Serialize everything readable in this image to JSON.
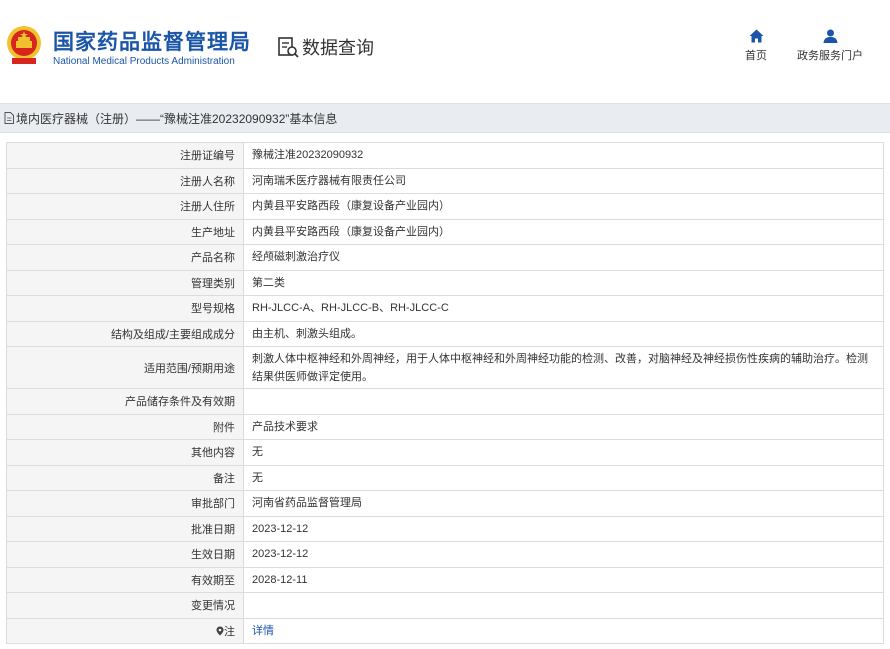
{
  "header": {
    "title_cn": "国家药品监督管理局",
    "title_en": "National Medical Products Administration",
    "query_label": "数据查询",
    "nav": {
      "home": "首页",
      "portal": "政务服务门户"
    }
  },
  "breadcrumb": {
    "text": "境内医疗器械（注册）——“豫械注准20232090932”基本信息"
  },
  "rows": [
    {
      "label": "注册证编号",
      "value": "豫械注准20232090932"
    },
    {
      "label": "注册人名称",
      "value": "河南瑞禾医疗器械有限责任公司"
    },
    {
      "label": "注册人住所",
      "value": "内黄县平安路西段（康复设备产业园内）"
    },
    {
      "label": "生产地址",
      "value": "内黄县平安路西段（康复设备产业园内）"
    },
    {
      "label": "产品名称",
      "value": "经颅磁刺激治疗仪"
    },
    {
      "label": "管理类别",
      "value": "第二类"
    },
    {
      "label": "型号规格",
      "value": "RH-JLCC-A、RH-JLCC-B、RH-JLCC-C"
    },
    {
      "label": "结构及组成/主要组成成分",
      "value": "由主机、刺激头组成。"
    },
    {
      "label": "适用范围/预期用途",
      "value": "刺激人体中枢神经和外周神经，用于人体中枢神经和外周神经功能的检测、改善，对脑神经及神经损伤性疾病的辅助治疗。检测结果供医师做评定使用。"
    },
    {
      "label": "产品储存条件及有效期",
      "value": ""
    },
    {
      "label": "附件",
      "value": "产品技术要求"
    },
    {
      "label": "其他内容",
      "value": "无"
    },
    {
      "label": "备注",
      "value": "无"
    },
    {
      "label": "审批部门",
      "value": "河南省药品监督管理局"
    },
    {
      "label": "批准日期",
      "value": "2023-12-12"
    },
    {
      "label": "生效日期",
      "value": "2023-12-12"
    },
    {
      "label": "有效期至",
      "value": "2028-12-11"
    },
    {
      "label": "变更情况",
      "value": ""
    },
    {
      "label": "注",
      "value": "详情"
    }
  ],
  "colors": {
    "brand": "#1a56a8",
    "emblem_red": "#d7261e",
    "emblem_gold": "#f2c12e"
  },
  "icons": {
    "emblem": "national-emblem",
    "query": "document-search-icon",
    "home": "home-icon",
    "portal": "user-icon",
    "breadcrumb": "document-icon",
    "note": "location-pin-icon"
  }
}
